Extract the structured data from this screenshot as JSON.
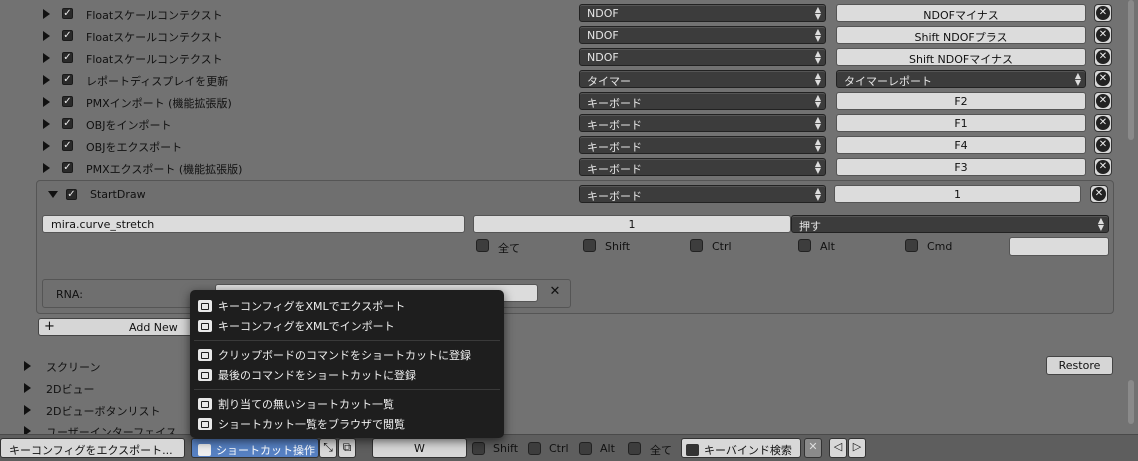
{
  "keymap_rows": [
    {
      "name": "Floatスケールコンテクスト",
      "type": "NDOF",
      "key": "NDOFマイナス"
    },
    {
      "name": "Floatスケールコンテクスト",
      "type": "NDOF",
      "key": "Shift NDOFプラス"
    },
    {
      "name": "Floatスケールコンテクスト",
      "type": "NDOF",
      "key": "Shift NDOFマイナス"
    },
    {
      "name": "レポートディスプレイを更新",
      "type": "タイマー",
      "key": "タイマーレポート"
    },
    {
      "name": "PMXインポート (機能拡張版)",
      "type": "キーボード",
      "key": "F2"
    },
    {
      "name": "OBJをインポート",
      "type": "キーボード",
      "key": "F1"
    },
    {
      "name": "OBJをエクスポート",
      "type": "キーボード",
      "key": "F4"
    },
    {
      "name": "PMXエクスポート (機能拡張版)",
      "type": "キーボード",
      "key": "F3"
    }
  ],
  "expanded": {
    "name": "StartDraw",
    "type": "キーボード",
    "key": "1",
    "operator": "mira.curve_stretch",
    "value": "1",
    "event": "押す",
    "modifiers": [
      "全て",
      "Shift",
      "Ctrl",
      "Alt",
      "Cmd"
    ],
    "rna_label": "RNA:",
    "add_new": "Add New"
  },
  "sections": [
    "スクリーン",
    "2Dビュー",
    "2Dビューボタンリスト",
    "ユーザーインターフェイス"
  ],
  "restore_label": "Restore",
  "menu": {
    "items": [
      "キーコンフィグをXMLでエクスポート",
      "キーコンフィグをXMLでインポート",
      "クリップボードのコマンドをショートカットに登録",
      "最後のコマンドをショートカットに登録",
      "割り当ての無いショートカット一覧",
      "ショートカット一覧をブラウザで閲覧"
    ]
  },
  "bottom": {
    "export": "キーコンフィグをエクスポート...",
    "shortcut_ops": "ショートカット操作",
    "search_key": "W",
    "shift": "Shift",
    "ctrl": "Ctrl",
    "alt": "Alt",
    "all": "全て",
    "keybind_search": "キーバインド検索"
  },
  "colors": {
    "menu_bg": "#1e1e1e",
    "highlight": "#5680c2",
    "panel_bg": "#727272"
  }
}
